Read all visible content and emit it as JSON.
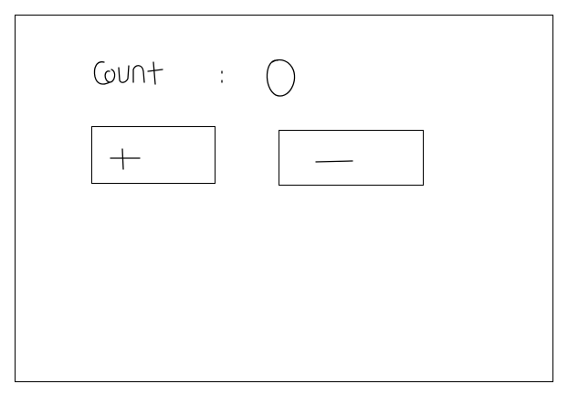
{
  "counter": {
    "label": "Count:",
    "value": "0"
  },
  "buttons": {
    "increment_label": "+",
    "decrement_label": "—"
  }
}
